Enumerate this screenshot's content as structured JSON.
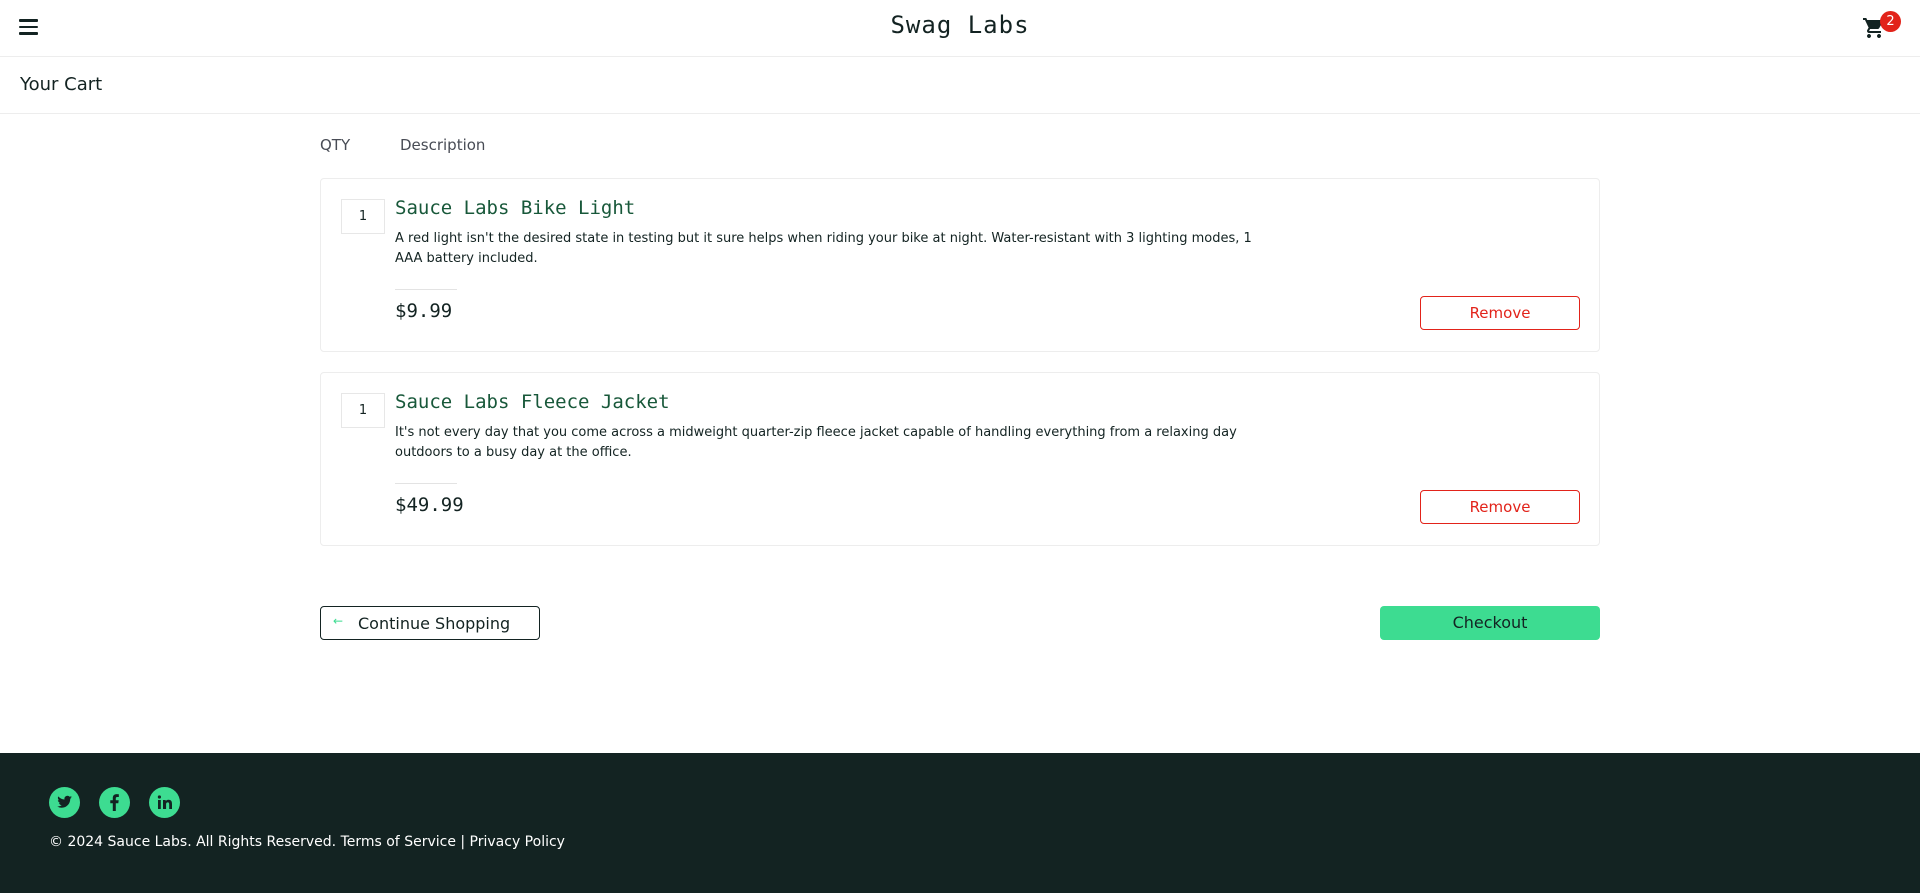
{
  "header": {
    "logo": "Swag Labs",
    "cart_badge": "2"
  },
  "sub_header": {
    "title": "Your Cart"
  },
  "cart": {
    "qty_label": "QTY",
    "desc_label": "Description",
    "items": [
      {
        "quantity": "1",
        "name": "Sauce Labs Bike Light",
        "description": "A red light isn't the desired state in testing but it sure helps when riding your bike at night. Water-resistant with 3 lighting modes, 1 AAA battery included.",
        "price": "$9.99",
        "remove_label": "Remove"
      },
      {
        "quantity": "1",
        "name": "Sauce Labs Fleece Jacket",
        "description": "It's not every day that you come across a midweight quarter-zip fleece jacket capable of handling everything from a relaxing day outdoors to a busy day at the office.",
        "price": "$49.99",
        "remove_label": "Remove"
      }
    ]
  },
  "actions": {
    "continue_label": "Continue Shopping",
    "checkout_label": "Checkout"
  },
  "footer": {
    "social": [
      "twitter-icon",
      "facebook-icon",
      "linkedin-icon"
    ],
    "copy": "© 2024 Sauce Labs. All Rights Reserved. Terms of Service | Privacy Policy"
  },
  "colors": {
    "accent": "#3ddc91",
    "danger": "#e2231a",
    "dark": "#132322",
    "item_name": "#18583a"
  }
}
